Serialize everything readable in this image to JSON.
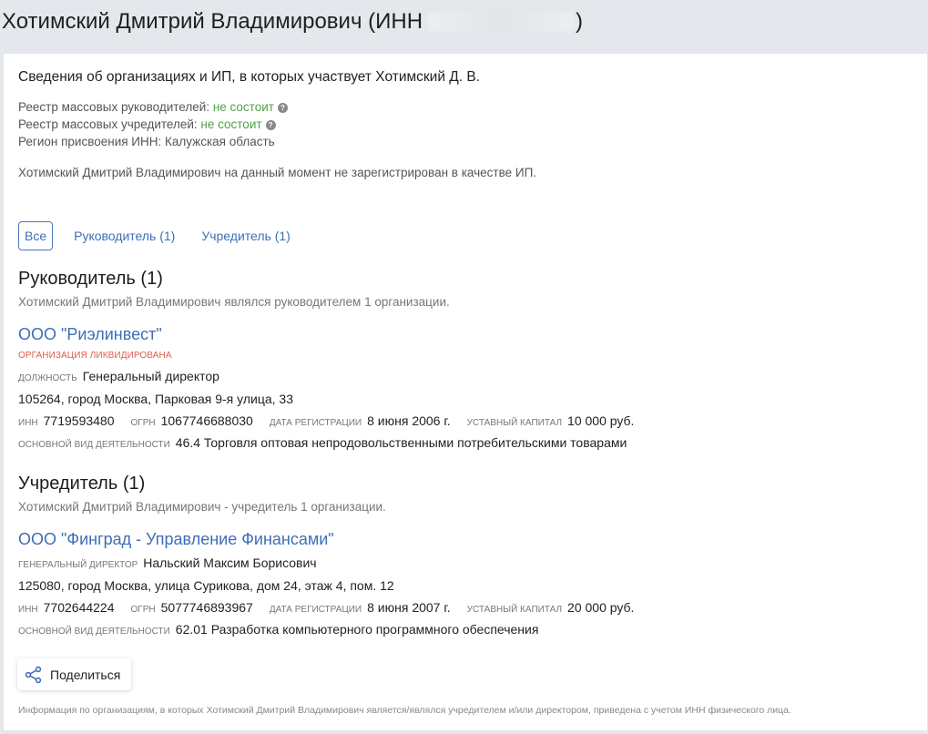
{
  "header": {
    "title_prefix": "Хотимский Дмитрий Владимирович (ИНН",
    "title_suffix": ")"
  },
  "intro": {
    "title": "Сведения об организациях и ИП, в которых участвует Хотимский Д. В.",
    "registry_leaders_label": "Реестр массовых руководителей:",
    "registry_leaders_value": "не состоит",
    "registry_founders_label": "Реестр массовых учредителей:",
    "registry_founders_value": "не состоит",
    "region_label": "Регион присвоения ИНН:",
    "region_value": "Калужская область",
    "ip_note": "Хотимский Дмитрий Владимирович на данный момент не зарегистрирован в качестве ИП."
  },
  "tabs": [
    {
      "label": "Все"
    },
    {
      "label": "Руководитель (1)"
    },
    {
      "label": "Учредитель (1)"
    }
  ],
  "leader_section": {
    "title": "Руководитель (1)",
    "subtitle": "Хотимский Дмитрий Владимирович являлся руководителем 1 организации.",
    "org": {
      "name": "ООО \"Риэлинвест\"",
      "status": "Организация ликвидирована",
      "position_label": "должность",
      "position_value": "Генеральный директор",
      "address": "105264, город Москва, Парковая 9-я улица, 33",
      "inn_label": "ИНН",
      "inn": "7719593480",
      "ogrn_label": "ОГРН",
      "ogrn": "1067746688030",
      "reg_date_label": "Дата регистрации",
      "reg_date": "8 июня 2006 г.",
      "capital_label": "Уставный капитал",
      "capital": "10 000 руб.",
      "activity_label": "Основной вид деятельности",
      "activity": "46.4 Торговля оптовая непродовольственными потребительскими товарами"
    }
  },
  "founder_section": {
    "title": "Учредитель (1)",
    "subtitle": "Хотимский Дмитрий Владимирович - учредитель 1 организации.",
    "org": {
      "name": "ООО \"Финград - Управление Финансами\"",
      "director_label": "Генеральный директор",
      "director_value": "Нальский Максим Борисович",
      "address": "125080, город Москва, улица Сурикова, дом 24, этаж 4, пом. 12",
      "inn_label": "ИНН",
      "inn": "7702644224",
      "ogrn_label": "ОГРН",
      "ogrn": "5077746893967",
      "reg_date_label": "Дата регистрации",
      "reg_date": "8 июня 2007 г.",
      "capital_label": "Уставный капитал",
      "capital": "20 000 руб.",
      "activity_label": "Основной вид деятельности",
      "activity": "62.01 Разработка компьютерного программного обеспечения"
    }
  },
  "share": {
    "label": "Поделиться",
    "icon": "share-icon"
  },
  "footnote": "Информация по организациям, в которых Хотимский Дмитрий Владимирович является/являлся учредителем и/или директором, приведена с учетом ИНН физического лица.",
  "colors": {
    "link": "#3d6fb6",
    "ok": "#4fa24a",
    "liquidated": "#e05a4e",
    "page_bg": "#e4e7ec"
  }
}
